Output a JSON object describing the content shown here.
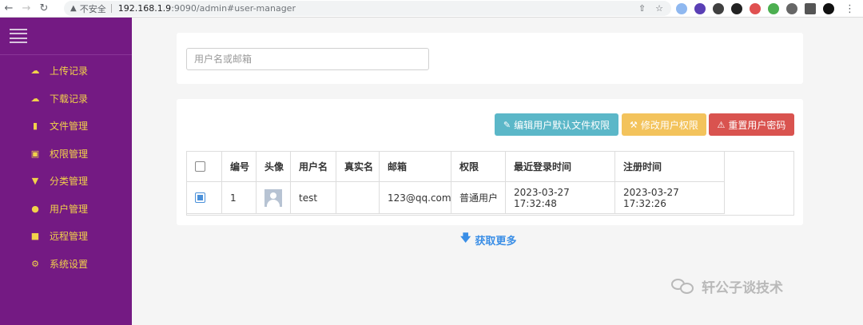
{
  "browser": {
    "insecure_label": "不安全",
    "url_host": "192.168.1.9",
    "url_path": ":9090/admin#user-manager"
  },
  "sidebar": {
    "items": [
      {
        "label": "上传记录",
        "icon": "cloud-upload-icon"
      },
      {
        "label": "下载记录",
        "icon": "cloud-download-icon"
      },
      {
        "label": "文件管理",
        "icon": "file-icon"
      },
      {
        "label": "权限管理",
        "icon": "lock-icon"
      },
      {
        "label": "分类管理",
        "icon": "filter-icon"
      },
      {
        "label": "用户管理",
        "icon": "user-icon"
      },
      {
        "label": "远程管理",
        "icon": "folder-icon"
      },
      {
        "label": "系统设置",
        "icon": "gear-icon"
      }
    ],
    "bg_color": "#741a83",
    "text_color": "#f2d24a"
  },
  "search": {
    "placeholder": "用户名或邮箱"
  },
  "toolbar": {
    "edit_default_perm_label": "编辑用户默认文件权限",
    "modify_perm_label": "修改用户权限",
    "reset_password_label": "重置用户密码"
  },
  "table": {
    "columns": [
      "",
      "编号",
      "头像",
      "用户名",
      "真实名",
      "邮箱",
      "权限",
      "最近登录时间",
      "注册时间"
    ],
    "rows": [
      {
        "checked": true,
        "id": "1",
        "username": "test",
        "realname": "",
        "email": "123@qq.com",
        "role": "普通用户",
        "last_login": "2023-03-27 17:32:48",
        "registered": "2023-03-27 17:32:26"
      }
    ]
  },
  "load_more_label": "获取更多",
  "watermark_text": "轩公子谈技术"
}
